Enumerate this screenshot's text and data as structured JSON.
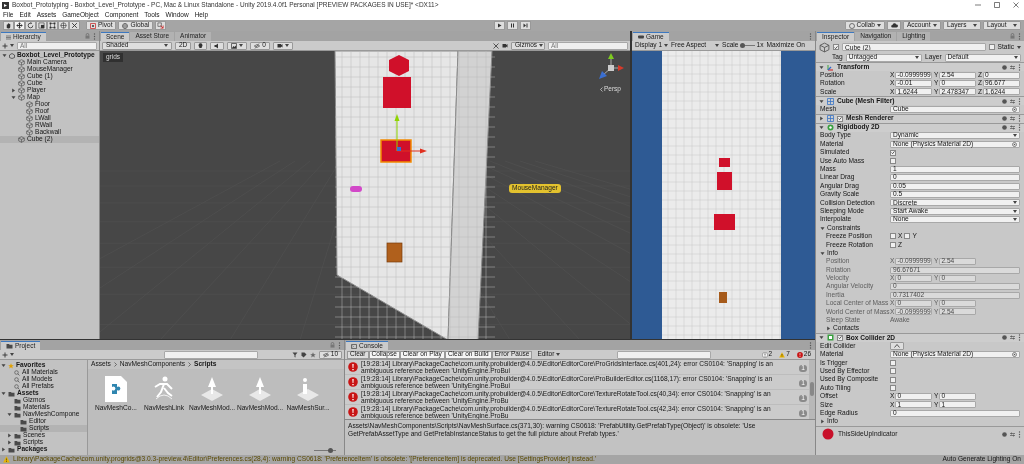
{
  "window": {
    "title": "Boxbot_Prototyping - Boxbot_Level_Prototype - PC, Mac & Linux Standalone - Unity 2019.4.0f1 Personal [PREVIEW PACKAGES IN USE]* <DX11>"
  },
  "menu": [
    "File",
    "Edit",
    "Assets",
    "GameObject",
    "Component",
    "Tools",
    "Window",
    "Help"
  ],
  "toolbar": {
    "tools": [
      {
        "kind": "hand",
        "selected": false
      },
      {
        "kind": "move",
        "selected": true
      },
      {
        "kind": "rotate",
        "selected": false
      },
      {
        "kind": "scale",
        "selected": false
      },
      {
        "kind": "rect",
        "selected": false
      },
      {
        "kind": "transform",
        "selected": false
      },
      {
        "kind": "custom",
        "selected": false
      }
    ],
    "pivot": "Pivot",
    "global": "Global",
    "collab": "Collab",
    "account": "Account",
    "layers": "Layers",
    "layout": "Layout"
  },
  "hierarchy": {
    "tab": "Hierarchy",
    "search_placeholder": "All",
    "scene": "Boxbot_Level_Prototype",
    "items": [
      {
        "label": "Main Camera",
        "selected": false
      },
      {
        "label": "MouseManager",
        "selected": false
      },
      {
        "label": "Cube (1)",
        "selected": false
      },
      {
        "label": "Cube",
        "selected": false
      },
      {
        "label": "Player",
        "selected": false,
        "expanded": false
      },
      {
        "label": "Map",
        "selected": false,
        "expanded": true,
        "children": [
          {
            "label": "Floor",
            "selected": false
          },
          {
            "label": "Roof",
            "selected": false
          },
          {
            "label": "LWall",
            "selected": false
          },
          {
            "label": "RWall",
            "selected": false
          },
          {
            "label": "Backwall",
            "selected": false
          }
        ]
      },
      {
        "label": "Cube (2)",
        "selected": true
      }
    ]
  },
  "scene": {
    "tabs": [
      {
        "label": "Scene",
        "selected": true
      },
      {
        "label": "Asset Store",
        "selected": false
      },
      {
        "label": "Animator",
        "selected": false
      }
    ],
    "shading": "Shaded",
    "mode_2d": "2D",
    "toggles": [
      {
        "kind": "lighting",
        "on": false
      },
      {
        "kind": "audio",
        "on": false
      }
    ],
    "hidden_count": "0",
    "gizmos": "Gizmos",
    "search_placeholder": "All",
    "overlay": "grids",
    "camera": "Persp",
    "labels": [
      "MouseManager"
    ]
  },
  "game": {
    "tab": "Game",
    "display": "Display 1",
    "aspect": "Free Aspect",
    "scale_label": "Scale",
    "scale": {
      "level": 0.15
    },
    "scale_reading": "1x",
    "maximize": "Maximize On"
  },
  "inspector": {
    "tabs": [
      {
        "label": "Inspector",
        "selected": true
      },
      {
        "label": "Navigation",
        "selected": false
      },
      {
        "label": "Lighting",
        "selected": false
      }
    ],
    "object": {
      "active": true,
      "name": "Cube (2)",
      "static": false,
      "static_label": "Static",
      "tag_label": "Tag",
      "tag": "Untagged",
      "layer_label": "Layer",
      "layer": "Default"
    },
    "components": [
      {
        "kind": "transform",
        "title": "Transform",
        "expanded": true,
        "rows": [
          {
            "kind": "vector",
            "label": "Position",
            "values": [
              {
                "axis": "X",
                "value": "-0.0999999"
              },
              {
                "axis": "Y",
                "value": "2.54"
              },
              {
                "axis": "Z",
                "value": "0"
              }
            ]
          },
          {
            "kind": "vector",
            "label": "Rotation",
            "values": [
              {
                "axis": "X",
                "value": "-0.01"
              },
              {
                "axis": "Y",
                "value": "0"
              },
              {
                "axis": "Z",
                "value": "96.677"
              }
            ]
          },
          {
            "kind": "vector",
            "label": "Scale",
            "values": [
              {
                "axis": "X",
                "value": "1.6244"
              },
              {
                "axis": "Y",
                "value": "2.478347"
              },
              {
                "axis": "Z",
                "value": "1.6244"
              }
            ]
          }
        ]
      },
      {
        "kind": "mesh_filter",
        "title": "Cube (Mesh Filter)",
        "expanded": true,
        "rows": [
          {
            "kind": "object",
            "label": "Mesh",
            "value": "Cube"
          }
        ]
      },
      {
        "kind": "mesh_renderer",
        "title": "Mesh Renderer",
        "expanded": false,
        "enabled": true
      },
      {
        "kind": "rigidbody",
        "title": "Rigidbody 2D",
        "expanded": true,
        "rows": [
          {
            "kind": "dropdown",
            "label": "Body Type",
            "value": "Dynamic"
          },
          {
            "kind": "object",
            "label": "Material",
            "value": "None (Physics Material 2D)"
          },
          {
            "kind": "checkbox",
            "label": "Simulated",
            "checked": true
          },
          {
            "kind": "checkbox",
            "label": "Use Auto Mass",
            "checked": false
          },
          {
            "kind": "text",
            "label": "Mass",
            "value": "1"
          },
          {
            "kind": "text",
            "label": "Linear Drag",
            "value": "0"
          },
          {
            "kind": "text",
            "label": "Angular Drag",
            "value": "0.05"
          },
          {
            "kind": "text",
            "label": "Gravity Scale",
            "value": "0.5"
          },
          {
            "kind": "dropdown",
            "label": "Collision Detection",
            "value": "Discrete"
          },
          {
            "kind": "dropdown",
            "label": "Sleeping Mode",
            "value": "Start Awake"
          },
          {
            "kind": "dropdown",
            "label": "Interpolate",
            "value": "None"
          },
          {
            "kind": "group",
            "label": "Constraints",
            "expanded": true,
            "children": [
              {
                "kind": "toggles",
                "label": "Freeze Position",
                "toggles": [
                  {
                    "axis": "X",
                    "checked": false
                  },
                  {
                    "axis": "Y",
                    "checked": false
                  }
                ]
              },
              {
                "kind": "toggles",
                "label": "Freeze Rotation",
                "toggles": [
                  {
                    "axis": "Z",
                    "checked": false
                  }
                ]
              }
            ]
          },
          {
            "kind": "group",
            "label": "Info",
            "expanded": true,
            "children": [
              {
                "kind": "vector",
                "label": "Position",
                "disabled": true,
                "values": [
                  {
                    "axis": "X",
                    "value": "-0.0999999"
                  },
                  {
                    "axis": "Y",
                    "value": "2.54"
                  }
                ]
              },
              {
                "kind": "text",
                "label": "Rotation",
                "disabled": true,
                "value": "96.67671"
              },
              {
                "kind": "vector",
                "label": "Velocity",
                "disabled": true,
                "values": [
                  {
                    "axis": "X",
                    "value": "0"
                  },
                  {
                    "axis": "Y",
                    "value": "0"
                  }
                ]
              },
              {
                "kind": "text",
                "label": "Angular Velocity",
                "disabled": true,
                "value": "0"
              },
              {
                "kind": "text",
                "label": "Inertia",
                "disabled": true,
                "value": "0.7317402"
              },
              {
                "kind": "vector",
                "label": "Local Center of Mass",
                "disabled": true,
                "values": [
                  {
                    "axis": "X",
                    "value": "0"
                  },
                  {
                    "axis": "Y",
                    "value": "0"
                  }
                ]
              },
              {
                "kind": "vector",
                "label": "World Center of Mass",
                "disabled": true,
                "values": [
                  {
                    "axis": "X",
                    "value": "-0.0999999"
                  },
                  {
                    "axis": "Y",
                    "value": "2.54"
                  }
                ]
              },
              {
                "kind": "readonly",
                "label": "Sleep State",
                "disabled": true,
                "value": "Awake"
              },
              {
                "kind": "group",
                "label": "Contacts",
                "expanded": false
              }
            ]
          }
        ]
      },
      {
        "kind": "box_collider",
        "title": "Box Collider 2D",
        "expanded": true,
        "enabled": true,
        "rows": [
          {
            "kind": "button",
            "label": "Edit Collider"
          },
          {
            "kind": "object",
            "label": "Material",
            "value": "None (Physics Material 2D)"
          },
          {
            "kind": "checkbox",
            "label": "Is Trigger",
            "checked": false
          },
          {
            "kind": "checkbox",
            "label": "Used By Effector",
            "checked": false
          },
          {
            "kind": "checkbox",
            "label": "Used By Composite",
            "checked": false
          },
          {
            "kind": "checkbox",
            "label": "Auto Tiling",
            "checked": false
          },
          {
            "kind": "vector",
            "label": "Offset",
            "values": [
              {
                "axis": "X",
                "value": "0"
              },
              {
                "axis": "Y",
                "value": "0"
              }
            ]
          },
          {
            "kind": "vector",
            "label": "Size",
            "values": [
              {
                "axis": "X",
                "value": "1"
              },
              {
                "axis": "Y",
                "value": "1"
              }
            ]
          },
          {
            "kind": "text",
            "label": "Edge Radius",
            "value": "0"
          },
          {
            "kind": "group",
            "label": "Info",
            "expanded": false
          }
        ]
      }
    ],
    "material": {
      "name": "ThisSideUpIndicator"
    }
  },
  "project": {
    "tab": "Project",
    "hidden_count": "10",
    "tree": [
      {
        "label": "Favorites",
        "kind": "favorites",
        "selected": false,
        "expanded": true,
        "children": [
          {
            "label": "All Materials",
            "kind": "search",
            "selected": false
          },
          {
            "label": "All Models",
            "kind": "search",
            "selected": false
          },
          {
            "label": "All Prefabs",
            "kind": "search",
            "selected": false
          }
        ]
      },
      {
        "label": "Assets",
        "kind": "folder",
        "selected": false,
        "expanded": true,
        "children": [
          {
            "label": "Gizmos",
            "kind": "folder",
            "selected": false
          },
          {
            "label": "Materials",
            "kind": "folder",
            "selected": false
          },
          {
            "label": "NavMeshCompone",
            "kind": "folder",
            "selected": false,
            "expanded": true,
            "children": [
              {
                "label": "Editor",
                "kind": "folder",
                "selected": false
              },
              {
                "label": "Scripts",
                "kind": "folder",
                "selected": true
              }
            ]
          },
          {
            "label": "Scenes",
            "kind": "folder",
            "selected": false,
            "expanded": false
          },
          {
            "label": "Scripts",
            "kind": "folder",
            "selected": false,
            "expanded": false
          }
        ]
      },
      {
        "label": "Packages",
        "kind": "folder",
        "selected": false,
        "expanded": false
      }
    ],
    "breadcrumb": [
      "Assets",
      "NavMeshComponents",
      "Scripts"
    ],
    "assets": [
      {
        "label": "NavMeshCo...",
        "kind": "script"
      },
      {
        "label": "NavMeshLink",
        "kind": "link"
      },
      {
        "label": "NavMeshMod...",
        "kind": "modifier"
      },
      {
        "label": "NavMeshMod...",
        "kind": "modifier"
      },
      {
        "label": "NavMeshSur...",
        "kind": "surface"
      }
    ],
    "zoom": {
      "level": 0.75
    }
  },
  "console": {
    "tab": "Console",
    "buttons": [
      {
        "label": "Clear",
        "selected": false
      },
      {
        "label": "Collapse",
        "selected": true
      },
      {
        "label": "Clear on Play",
        "selected": true
      },
      {
        "label": "Clear on Build",
        "selected": true
      },
      {
        "label": "Error Pause",
        "selected": false
      }
    ],
    "editor": "Editor",
    "counts": [
      {
        "kind": "info",
        "count": "2"
      },
      {
        "kind": "warning",
        "count": "7"
      },
      {
        "kind": "error",
        "count": "26"
      }
    ],
    "messages": [
      {
        "kind": "error",
        "text": "[19:28:14] Library\\PackageCache\\com.unity.probuilder@4.0.5\\Editor\\EditorCore\\ProGridsInterface.cs(401,24): error CS0104: 'Snapping' is an ambiguous reference between 'UnityEngine.ProBui",
        "count": "1"
      },
      {
        "kind": "error",
        "text": "[19:28:14] Library\\PackageCache\\com.unity.probuilder@4.0.5\\Editor\\EditorCore\\ProBuilderEditor.cs(1168,17): error CS0104: 'Snapping' is an ambiguous reference between 'UnityEngine.ProBui",
        "count": "1"
      },
      {
        "kind": "error",
        "text": "[19:28:14] Library\\PackageCache\\com.unity.probuilder@4.0.5\\Editor\\EditorCore\\TextureRotateTool.cs(40,34): error CS0104: 'Snapping' is an ambiguous reference between 'UnityEngine.ProBu",
        "count": "1"
      },
      {
        "kind": "error",
        "text": "[19:28:14] Library\\PackageCache\\com.unity.probuilder@4.0.5\\Editor\\EditorCore\\TextureRotateTool.cs(42,34): error CS0104: 'Snapping' is an ambiguous reference between 'UnityEngine.ProBu",
        "count": "1"
      }
    ],
    "detail": "Assets\\NavMeshComponents\\Scripts\\NavMeshSurface.cs(371,30): warning CS0618: 'PrefabUtility.GetPrefabType(Object)' is obsolete: 'Use GetPrefabAssetType and GetPrefabInstanceStatus to get the full picture about Prefab types.'"
  },
  "status_bar": {
    "kind": "warning",
    "message": "Library\\PackageCache\\com.unity.progrids@3.0.3-preview.4\\Editor\\Preferences.cs(28,4): warning CS0618: 'PreferenceItem' is obsolete: '[PreferenceItem] is deprecated. Use [SettingsProvider] instead.'",
    "lighting": "Auto Generate Lighting On"
  }
}
